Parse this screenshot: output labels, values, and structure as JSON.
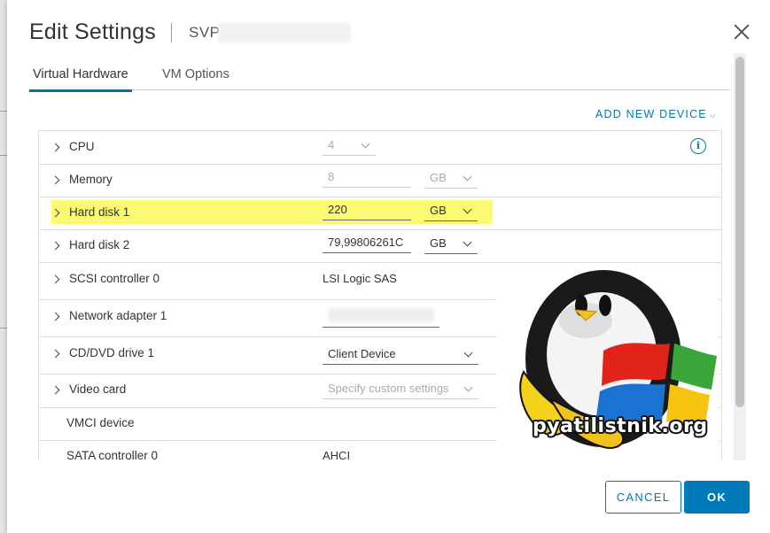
{
  "dialog": {
    "title": "Edit Settings",
    "vm_name": "SVP"
  },
  "tabs": [
    {
      "label": "Virtual Hardware",
      "active": true
    },
    {
      "label": "VM Options",
      "active": false
    }
  ],
  "add_device": {
    "label": "ADD NEW DEVICE"
  },
  "rows": {
    "cpu": {
      "label": "CPU",
      "value": "4"
    },
    "memory": {
      "label": "Memory",
      "value": "8",
      "unit": "GB"
    },
    "hard_disk_1": {
      "label": "Hard disk 1",
      "value": "220",
      "unit": "GB",
      "highlight_color": "#fbfa72"
    },
    "hard_disk_2": {
      "label": "Hard disk 2",
      "value": "79,99806261C",
      "unit": "GB"
    },
    "scsi": {
      "label": "SCSI controller 0",
      "value": "LSI Logic SAS"
    },
    "network": {
      "label": "Network adapter 1"
    },
    "cd_dvd": {
      "label": "CD/DVD drive 1",
      "value": "Client Device"
    },
    "video": {
      "label": "Video card",
      "value": "Specify custom settings"
    },
    "vmci": {
      "label": "VMCI device"
    },
    "sata": {
      "label": "SATA controller 0",
      "value": "AHCI"
    }
  },
  "info_icon": {
    "glyph": "i"
  },
  "watermark": {
    "text": "pyatilistnik.org"
  },
  "footer": {
    "cancel_label": "CANCEL",
    "ok_label": "OK"
  },
  "colors": {
    "accent": "#0079b8",
    "highlight": "#fbfa72"
  }
}
